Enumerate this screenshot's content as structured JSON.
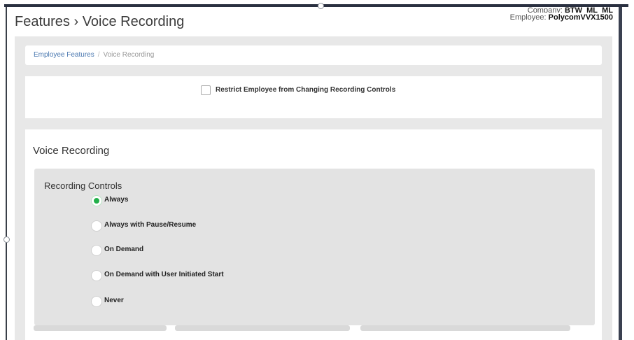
{
  "header": {
    "title": "Features › Voice Recording",
    "company_label": "Company:",
    "company_value": "BTW_ML_ML",
    "employee_label": "Employee:",
    "employee_value": "PolycomVVX1500"
  },
  "breadcrumb": {
    "link": "Employee Features",
    "separator": "/",
    "current": "Voice Recording"
  },
  "restrict": {
    "label": "Restrict Employee from Changing Recording Controls",
    "checked": false
  },
  "recording": {
    "section_title": "Voice Recording",
    "controls_title": "Recording Controls",
    "options": [
      {
        "label": "Always",
        "selected": true
      },
      {
        "label": "Always with Pause/Resume",
        "selected": false
      },
      {
        "label": "On Demand",
        "selected": false
      },
      {
        "label": "On Demand with User Initiated Start",
        "selected": false
      },
      {
        "label": "Never",
        "selected": false
      }
    ]
  },
  "colors": {
    "selected_radio": "#22b04a",
    "breadcrumb_link": "#4a78b0",
    "panel_bg": "#e8e8e8"
  }
}
